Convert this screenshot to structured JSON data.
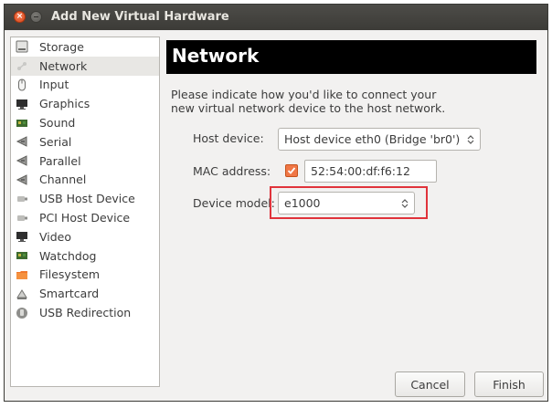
{
  "window": {
    "title": "Add New Virtual Hardware"
  },
  "sidebar": {
    "items": [
      {
        "label": "Storage",
        "icon": "hard-disk-icon"
      },
      {
        "label": "Network",
        "icon": "network-icon",
        "selected": true
      },
      {
        "label": "Input",
        "icon": "mouse-icon"
      },
      {
        "label": "Graphics",
        "icon": "monitor-icon"
      },
      {
        "label": "Sound",
        "icon": "sound-card-icon"
      },
      {
        "label": "Serial",
        "icon": "serial-port-icon"
      },
      {
        "label": "Parallel",
        "icon": "parallel-port-icon"
      },
      {
        "label": "Channel",
        "icon": "channel-icon"
      },
      {
        "label": "USB Host Device",
        "icon": "usb-device-icon"
      },
      {
        "label": "PCI Host Device",
        "icon": "pci-device-icon"
      },
      {
        "label": "Video",
        "icon": "video-icon"
      },
      {
        "label": "Watchdog",
        "icon": "watchdog-icon"
      },
      {
        "label": "Filesystem",
        "icon": "folder-icon"
      },
      {
        "label": "Smartcard",
        "icon": "smartcard-icon"
      },
      {
        "label": "USB Redirection",
        "icon": "usb-redirection-icon"
      }
    ]
  },
  "main": {
    "header": "Network",
    "description_line1": "Please indicate how you'd like to connect your",
    "description_line2": "new virtual network device to the host network.",
    "host_device": {
      "label": "Host device:",
      "value": "Host device eth0 (Bridge 'br0')"
    },
    "mac_address": {
      "label": "MAC address:",
      "checked": true,
      "value": "52:54:00:df:f6:12"
    },
    "device_model": {
      "label": "Device model:",
      "value": "e1000"
    }
  },
  "buttons": {
    "cancel": "Cancel",
    "finish": "Finish"
  },
  "colors": {
    "accent": "#f07746",
    "highlight_box": "#e0333b",
    "header_bg": "#000000"
  }
}
